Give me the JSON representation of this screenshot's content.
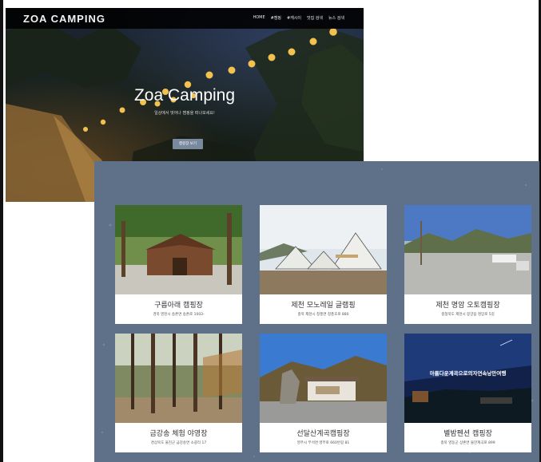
{
  "header": {
    "logo": "ZOA CAMPING",
    "nav": [
      "HOME",
      "#캠핑",
      "#캐시이",
      "맛집 검색",
      "뉴스 검색"
    ]
  },
  "hero": {
    "title": "Zoa Camping",
    "subtitle": "일상에서 벗어나 캠핑을 떠나보세요!",
    "button_label": "캠핑장 보기"
  },
  "cards": [
    {
      "title": "구름아래 캠핑장",
      "address": "경북 영천시 송촌면 송촌로 1003-"
    },
    {
      "title": "제천 모노레일 글램핑",
      "address": "충북 제천시 청풍면 청풍호로 880"
    },
    {
      "title": "제천 명암 오토캠핑장",
      "address": "충청북도 제천시 봉양읍 명암로 5길"
    },
    {
      "title": "금강송 체험 야영장",
      "address": "경상북도 울진군 금강송면 소광리 17"
    },
    {
      "title": "선달산계곡캠핑장",
      "address": "영주시 부석면 영부로 660번길 81"
    },
    {
      "title": "별밤펜션 캠핑장",
      "address": "충북 영동군 상촌면 물한계곡로 899"
    }
  ],
  "card_photo_overlay_text": "아름다운계곡으로의자연속낭만여행"
}
